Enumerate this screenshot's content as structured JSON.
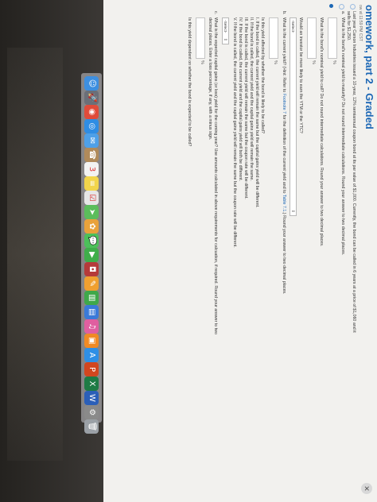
{
  "header": {
    "title": "omework, part 2 - Graded",
    "due": "ow at 11:59 PM CST",
    "close_icon": "✕"
  },
  "problem": {
    "intro_line1": "Last year Carson Industries issued a 10-year, 12% semiannual coupon bond at its par value of $1,000. Currently, the bond can be called in 6 years at a price of $1,060 and it",
    "intro_line2": "sells for $1,250.",
    "part_a_label": "a.",
    "part_a_q1": "What is the bond's nominal yield to maturity? Do not round intermediate calculations. Round your answer to two decimal places.",
    "pct": "%",
    "part_a_q2": "What is the bond's nominal yield to call? Do not round intermediate calculations. Round your answer to two decimal places.",
    "part_a_q3": "Would an investor be more likely to earn the YTM or the YTC?",
    "select_label": "-Select-",
    "part_b_label": "b.",
    "part_b_q_pre": "What is the current yield? (Hint: Refer to ",
    "part_b_link1": "Footnote 7",
    "part_b_q_mid": " for the definition of the current yield and to ",
    "part_b_link2": "Table 7.1",
    "part_b_q_post": ".) Round your answer to two decimal places.",
    "part_b_q2": "Is this yield affected by whether the bond is likely to be called?",
    "options": [
      "I.   If the bond is called, the current yield will remain the same but the capital gains yield will be different.",
      "II.  If the bond is called, the current yield and the capital gains yield will remain the same.",
      "III. If the bond is called, the current yield will remain the same but the coupon rate will be different.",
      "IV.  If the bond is called, the current yield and the capital gains yield will both be different.",
      "V.   If the bond is called, the current yield and the capital gains yield will remain the same but the coupon rate will be different."
    ],
    "part_c_label": "c.",
    "part_c_q_line1": "What is the expected capital gains (or loss) yield for the coming year? Use amounts calculated in above requirements for calcuation, if required. Round your answer to two",
    "part_c_q_line2": "decimal places. Enter a loss percentage, if any, with a minus sign.",
    "part_c_q2": "Is this yield dependent on whether the bond is expected to be called?"
  },
  "dock": {
    "items": [
      {
        "name": "finder",
        "glyph": "☺",
        "color": "#3d8fe0"
      },
      {
        "name": "launchpad",
        "glyph": "🚀",
        "color": "#6b6f78"
      },
      {
        "name": "chrome",
        "glyph": "◉",
        "color": "#e04b3a"
      },
      {
        "name": "safari",
        "glyph": "◎",
        "color": "#2f8de4"
      },
      {
        "name": "mail",
        "glyph": "✉",
        "color": "#4ea0e8"
      },
      {
        "name": "contacts",
        "glyph": "☎",
        "color": "#b08a5a"
      },
      {
        "name": "calendar",
        "glyph": "3",
        "color": "#f3f3f3"
      },
      {
        "name": "notes",
        "glyph": "≡",
        "color": "#f2d54b"
      },
      {
        "name": "reminders",
        "glyph": "☑",
        "color": "#e6e6e6"
      },
      {
        "name": "maps",
        "glyph": "➤",
        "color": "#5bbd5b"
      },
      {
        "name": "photos",
        "glyph": "✿",
        "color": "#e9a23b"
      },
      {
        "name": "messages",
        "glyph": "💬",
        "color": "#4cc05a"
      },
      {
        "name": "facetime",
        "glyph": "▶",
        "color": "#3fae4a"
      },
      {
        "name": "photo-booth",
        "glyph": "◘",
        "color": "#b53a3a"
      },
      {
        "name": "pages",
        "glyph": "✎",
        "color": "#f0a030"
      },
      {
        "name": "numbers",
        "glyph": "▥",
        "color": "#3fa84a"
      },
      {
        "name": "keynote",
        "glyph": "▤",
        "color": "#3a7ad8"
      },
      {
        "name": "itunes",
        "glyph": "♫",
        "color": "#e05fa0"
      },
      {
        "name": "ibooks",
        "glyph": "▣",
        "color": "#f08a24"
      },
      {
        "name": "app-store",
        "glyph": "A",
        "color": "#2e8fe6"
      },
      {
        "name": "powerpoint",
        "glyph": "P",
        "color": "#d2461f"
      },
      {
        "name": "excel",
        "glyph": "X",
        "color": "#1e7b45"
      },
      {
        "name": "word",
        "glyph": "W",
        "color": "#2b5fb8"
      },
      {
        "name": "system-preferences",
        "glyph": "⚙",
        "color": "#8a8a8a"
      },
      {
        "name": "trash",
        "glyph": "🗑",
        "color": "#9aa0a6"
      }
    ]
  }
}
